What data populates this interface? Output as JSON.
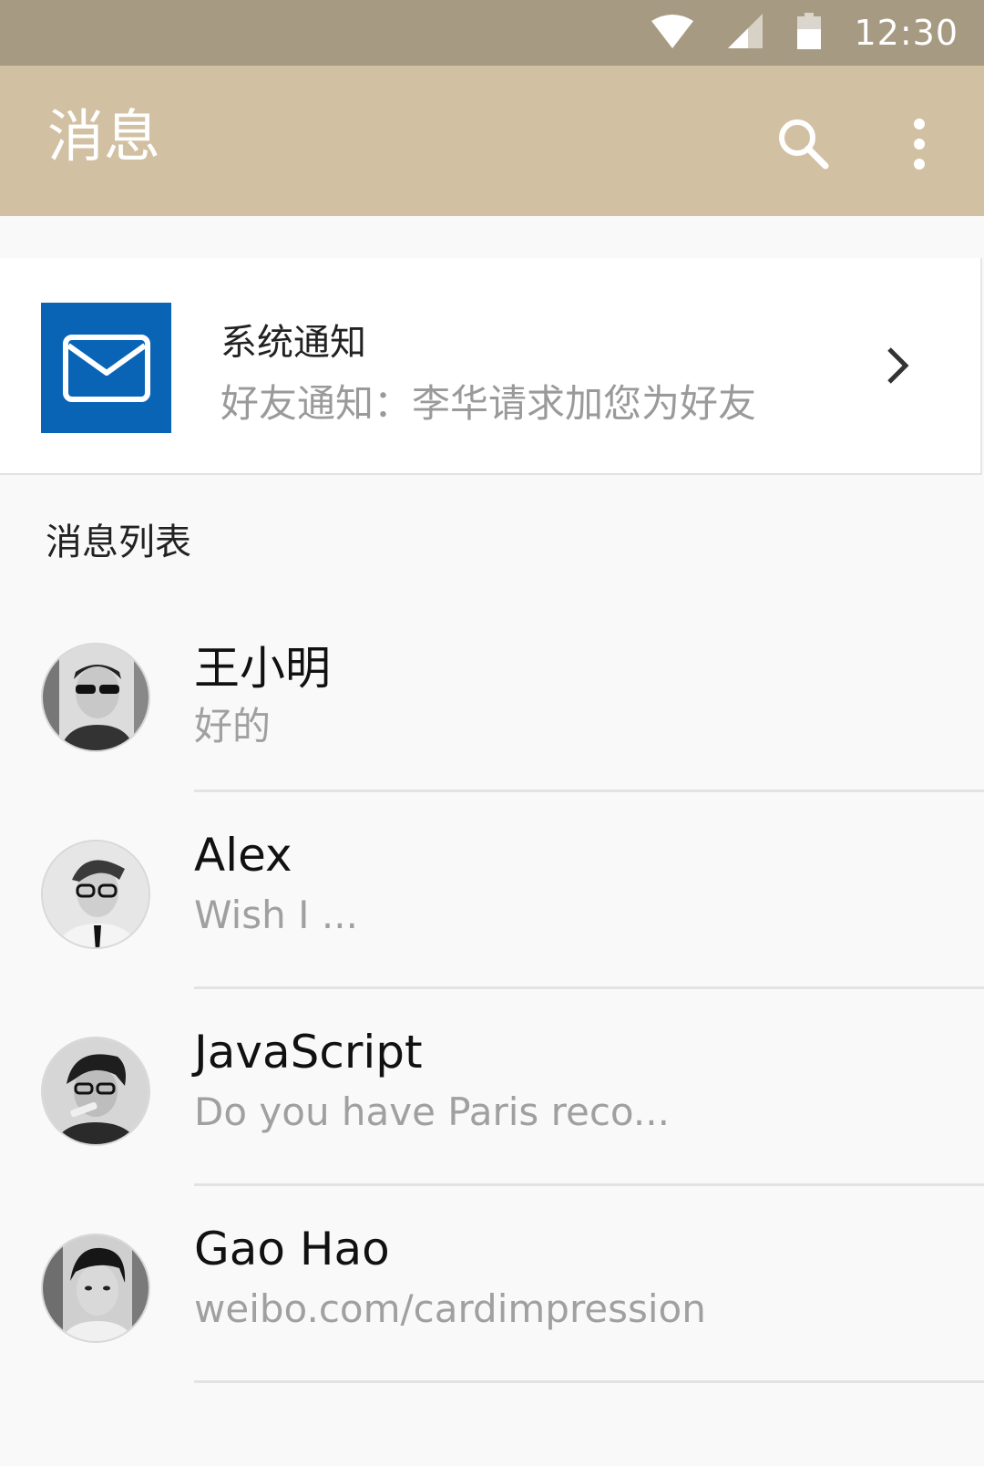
{
  "status_bar": {
    "time": "12:30",
    "icons": [
      "wifi-icon",
      "cellular-signal-icon",
      "battery-icon"
    ]
  },
  "app_bar": {
    "title": "消息",
    "icons": [
      "search-icon",
      "more-vert-icon"
    ],
    "background": "#d2c0a3"
  },
  "notice": {
    "title": "系统通知",
    "subtitle": "好友通知：李华请求加您为好友",
    "icon": "mail-icon",
    "icon_background": "#0a64b6"
  },
  "list": {
    "header": "消息列表",
    "items": [
      {
        "name": "王小明",
        "preview": "好的",
        "avatar": "avatar-icon"
      },
      {
        "name": "Alex",
        "preview": "Wish I ...",
        "avatar": "avatar-icon"
      },
      {
        "name": "JavaScript",
        "preview": "Do you have Paris reco...",
        "avatar": "avatar-icon"
      },
      {
        "name": "Gao Hao",
        "preview": "weibo.com/cardimpression",
        "avatar": "avatar-icon"
      }
    ]
  }
}
